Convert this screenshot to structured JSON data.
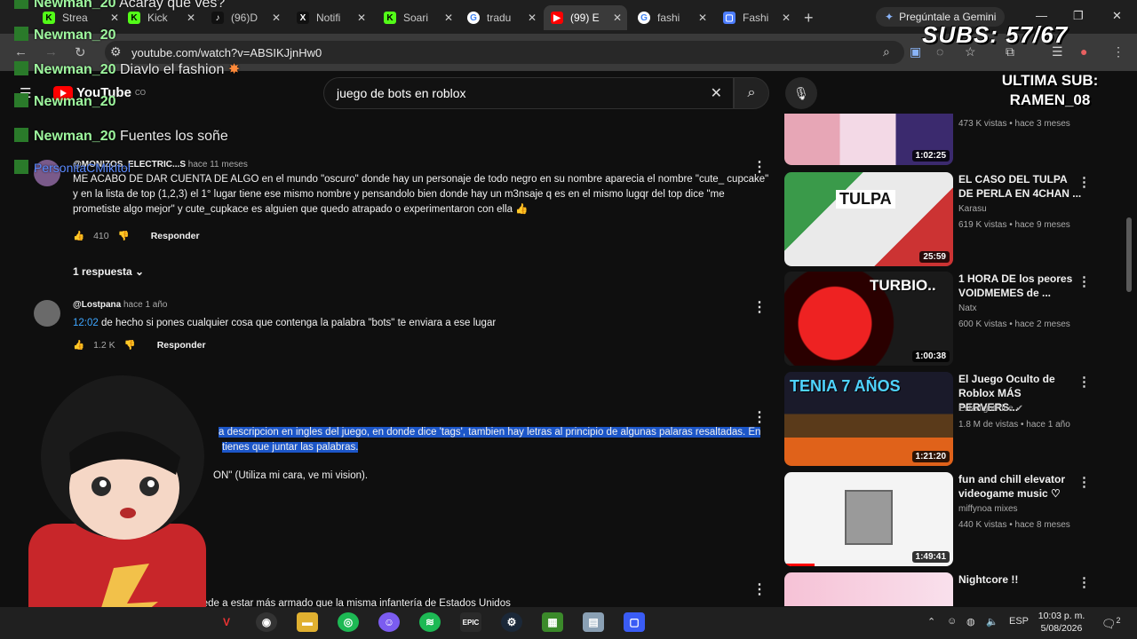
{
  "browser": {
    "tabs": [
      {
        "label": "Strea",
        "icon": "kick-icon",
        "color": "#53fc18"
      },
      {
        "label": "Kick",
        "icon": "kick-icon",
        "color": "#53fc18"
      },
      {
        "label": "(96)D",
        "icon": "tiktok-icon",
        "color": "#000000"
      },
      {
        "label": "Notifi",
        "icon": "x-icon",
        "color": "#000000"
      },
      {
        "label": "Soari",
        "icon": "kick-icon",
        "color": "#53fc18"
      },
      {
        "label": "tradu",
        "icon": "google-icon",
        "color": "#ffffff"
      },
      {
        "label": "(99) E",
        "icon": "youtube-icon",
        "color": "#ff0000"
      },
      {
        "label": "fashi",
        "icon": "google-icon",
        "color": "#ffffff"
      },
      {
        "label": "Fashi",
        "icon": "doc-icon",
        "color": "#4c7dff"
      }
    ],
    "gemini_label": "Pregúntale a Gemini",
    "url": "youtube.com/watch?v=ABSIKJjnHw0"
  },
  "youtube": {
    "logo": "YouTube",
    "logo_sup": "CO",
    "search_value": "juego de bots en roblox"
  },
  "overlay": {
    "subs": "SUBS: 57/67",
    "ultima_label": "ULTIMA SUB:",
    "ultima_name": "RAMEN_08",
    "chat": [
      {
        "name": "Newman_20",
        "text": "Acaray que ves?"
      },
      {
        "name": "Newman_20",
        "text": ""
      },
      {
        "name": "Newman_20",
        "text": "Diavlo el fashion"
      },
      {
        "name": "Newman_20",
        "text": ""
      },
      {
        "name": "Newman_20",
        "text": "Fuentes los soñe"
      },
      {
        "name": "PersonitaCMikitol",
        "text": ""
      }
    ]
  },
  "comments": [
    {
      "author": "@MONIZOS_ELECTRIC...S",
      "time": "hace 11 meses",
      "text": "ME ACABO DE DAR CUENTA DE ALGO en el mundo \"oscuro\" donde hay un personaje de todo negro en su nombre aparecia el nombre  \"cute_ cupcake\" y en la lista de top (1,2,3) el 1° lugar tiene ese mismo nombre y pensandolo bien donde hay un m3nsaje q es en el mismo lugqr del top dice \"me prometiste algo mejor\" y cute_cupkace es alguien que quedo atrapado o experimentaron con ella 👍",
      "likes": "410",
      "reply": "Responder",
      "replies": "1 respuesta"
    },
    {
      "author": "@Lostpana",
      "time": "hace 1 año",
      "timestamp": "12:02",
      "text": "de hecho si pones cualquier cosa que contenga la palabra \"bots\" te enviara a ese lugar",
      "likes": "1.2 K",
      "reply": "Responder"
    },
    {
      "text_line1": "a descripcion en ingles del juego, en donde dice 'tags', tambien hay letras al principio de algunas palaras resaltadas. En",
      "text_line2": "tienes que juntar las palabras.",
      "text_line3": "ON\" (Utiliza mi cara, ve mi vision)."
    },
    {
      "text": "cede a estar más armado que la misma infantería de Estados Unidos"
    }
  ],
  "sidebar": [
    {
      "title": "",
      "channel": "",
      "meta": "473 K vistas • hace 3 meses",
      "duration": "1:02:25"
    },
    {
      "title": "EL CASO DEL TULPA DE PERLA EN 4CHAN ...",
      "channel": "Karasu",
      "meta": "619 K vistas • hace 9 meses",
      "duration": "25:59",
      "thumb_text": "TULPA"
    },
    {
      "title": "1 HORA DE los peores VOIDMEMES de ...",
      "channel": "Natx",
      "meta": "600 K vistas • hace 2 meses",
      "duration": "1:00:38",
      "thumb_text": "TURBIO.."
    },
    {
      "title": "El Juego Oculto de Roblox MÁS PERVERS...",
      "channel": "EstarlightPibe",
      "meta": "1.8 M de vistas • hace 1 año",
      "duration": "1:21:20",
      "thumb_text": "TENIA 7 AÑOS"
    },
    {
      "title": "fun and chill elevator videogame music ♡",
      "channel": "miffynoa mixes",
      "meta": "440 K vistas • hace 8 meses",
      "duration": "1:49:41"
    },
    {
      "title": "Nightcore !!",
      "channel": "",
      "meta": "",
      "duration": ""
    }
  ],
  "taskbar": {
    "lang": "ESP",
    "time": "10:03 p. m.",
    "date": "5/08/2026",
    "notif": "2"
  }
}
